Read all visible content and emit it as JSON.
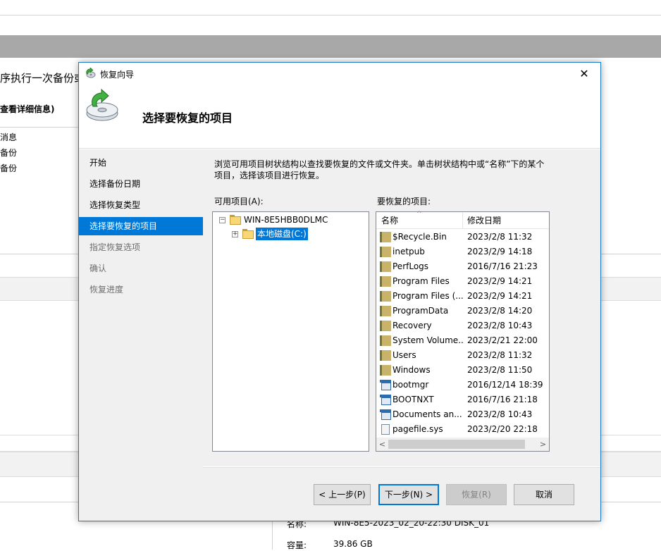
{
  "background": {
    "line1": "序执行一次备份或",
    "link": "查看详细信息)",
    "items": [
      "消息",
      "备份",
      "备份"
    ],
    "bottom_field_label": "名称:",
    "bottom_field_value": "WIN-8E5-2023_02_20-22:30 DISK_01",
    "capacity_label": "容量:",
    "capacity_value": "39.86 GB"
  },
  "dialog": {
    "title": "恢复向导",
    "heading": "选择要恢复的项目",
    "close_glyph": "✕",
    "nav": [
      {
        "label": "开始",
        "state": "normal"
      },
      {
        "label": "选择备份日期",
        "state": "normal"
      },
      {
        "label": "选择恢复类型",
        "state": "normal"
      },
      {
        "label": "选择要恢复的项目",
        "state": "selected"
      },
      {
        "label": "指定恢复选项",
        "state": "disabled"
      },
      {
        "label": "确认",
        "state": "disabled"
      },
      {
        "label": "恢复进度",
        "state": "disabled"
      }
    ],
    "description": "浏览可用项目树状结构以查找要恢复的文件或文件夹。单击树状结构中或“名称”下的某个项目，选择该项目进行恢复。",
    "available_label": "可用项目(A):",
    "restore_label": "要恢复的项目:",
    "tree": {
      "root": "WIN-8E5HBB0DLMC",
      "child": "本地磁盘(C:)",
      "root_expander": "−",
      "child_expander": "+"
    },
    "list": {
      "col_name": "名称",
      "col_date": "修改日期",
      "rows": [
        {
          "name": "$Recycle.Bin",
          "date": "2023/2/8 11:32",
          "icon": "folder-icon"
        },
        {
          "name": "inetpub",
          "date": "2023/2/9 14:18",
          "icon": "folder-icon"
        },
        {
          "name": "PerfLogs",
          "date": "2016/7/16 21:23",
          "icon": "folder-icon"
        },
        {
          "name": "Program Files",
          "date": "2023/2/9 14:21",
          "icon": "folder-icon"
        },
        {
          "name": "Program Files (...",
          "date": "2023/2/9 14:21",
          "icon": "folder-icon"
        },
        {
          "name": "ProgramData",
          "date": "2023/2/8 14:20",
          "icon": "folder-icon"
        },
        {
          "name": "Recovery",
          "date": "2023/2/8 10:43",
          "icon": "folder-icon"
        },
        {
          "name": "System Volume...",
          "date": "2023/2/21 22:00",
          "icon": "folder-icon"
        },
        {
          "name": "Users",
          "date": "2023/2/8 11:32",
          "icon": "folder-icon"
        },
        {
          "name": "Windows",
          "date": "2023/2/8 11:50",
          "icon": "folder-icon"
        },
        {
          "name": "bootmgr",
          "date": "2016/12/14 18:39",
          "icon": "system-file-icon"
        },
        {
          "name": "BOOTNXT",
          "date": "2016/7/16 21:18",
          "icon": "system-file-icon"
        },
        {
          "name": "Documents an...",
          "date": "2023/2/8 10:43",
          "icon": "shortcut-icon"
        },
        {
          "name": "pagefile.sys",
          "date": "2023/2/20 22:18",
          "icon": "page-file-icon"
        }
      ]
    },
    "buttons": {
      "prev": "< 上一步(P)",
      "next": "下一步(N) >",
      "restore": "恢复(R)",
      "cancel": "取消"
    }
  },
  "colors": {
    "accent": "#0078d7",
    "dialog_border": "#1979ca",
    "panel": "#f0f0f0"
  }
}
